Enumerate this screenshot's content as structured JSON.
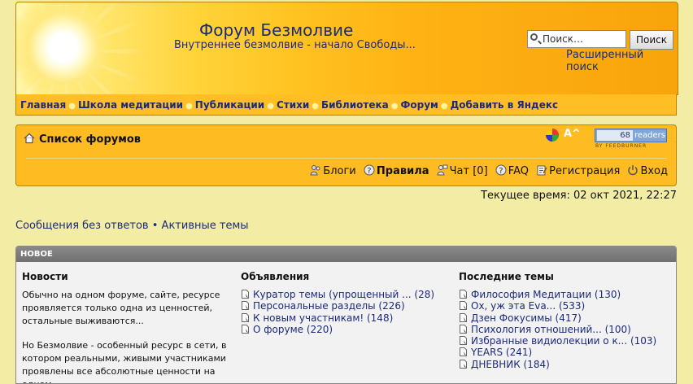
{
  "header": {
    "title": "Форум Безмолвие",
    "subtitle": "Внутреннее безмолвие - начало Свободы...",
    "search_placeholder": "Поиск…",
    "search_button": "Поиск",
    "advanced_search": "Расширенный поиск"
  },
  "nav": {
    "items": [
      "Главная",
      "Школа медитации",
      "Публикации",
      "Стихи",
      "Библиотека",
      "Форум",
      "Добавить в Яндекс"
    ]
  },
  "panel": {
    "forum_list": "Список форумов",
    "readers_count": "68",
    "readers_label": "readers",
    "feed_by": "BY FEEDBURNER",
    "font_change": "A^",
    "links": {
      "blogs": "Блоги",
      "rules": "Правила",
      "chat": "Чат [0]",
      "faq": "FAQ",
      "register": "Регистрация",
      "login": "Вход"
    }
  },
  "time": "Текущее время: 02 окт 2021, 22:27",
  "quick_links": {
    "unanswered": "Сообщения без ответов",
    "separator": "•",
    "active": "Активные темы"
  },
  "new_box": {
    "header": "НОВОЕ",
    "news": {
      "title": "Новости",
      "para1": "Обычно на одном форуме, сайте, ресурсе проявляется только одна из ценностей, остальные выживаются...",
      "para2": "Но Безмолвие - особенный ресурс в сети, в котором реальными, живыми участниками проявлены все абсолютные ценности на одном"
    },
    "announcements": {
      "title": "Объявления",
      "items": [
        "Куратор темы (упрощенный ... (28)",
        "Персональные разделы (226)",
        "К новым участникам! (148)",
        "О форуме (220)"
      ]
    },
    "latest": {
      "title": "Последние темы",
      "items": [
        "Философия Медитации (130)",
        "Ох, уж эта Eva... (533)",
        "Дзен Фокусимы (417)",
        "Психология отношений... (100)",
        "Избранные видиолекции о к... (103)",
        "YEARS (241)",
        "ДНЕВНИК (184)"
      ]
    }
  },
  "colors": {
    "link": "#1b2a7a",
    "background": "#f2eca4",
    "panel": "#ffbb22",
    "box_header": "#7a7a7a"
  }
}
